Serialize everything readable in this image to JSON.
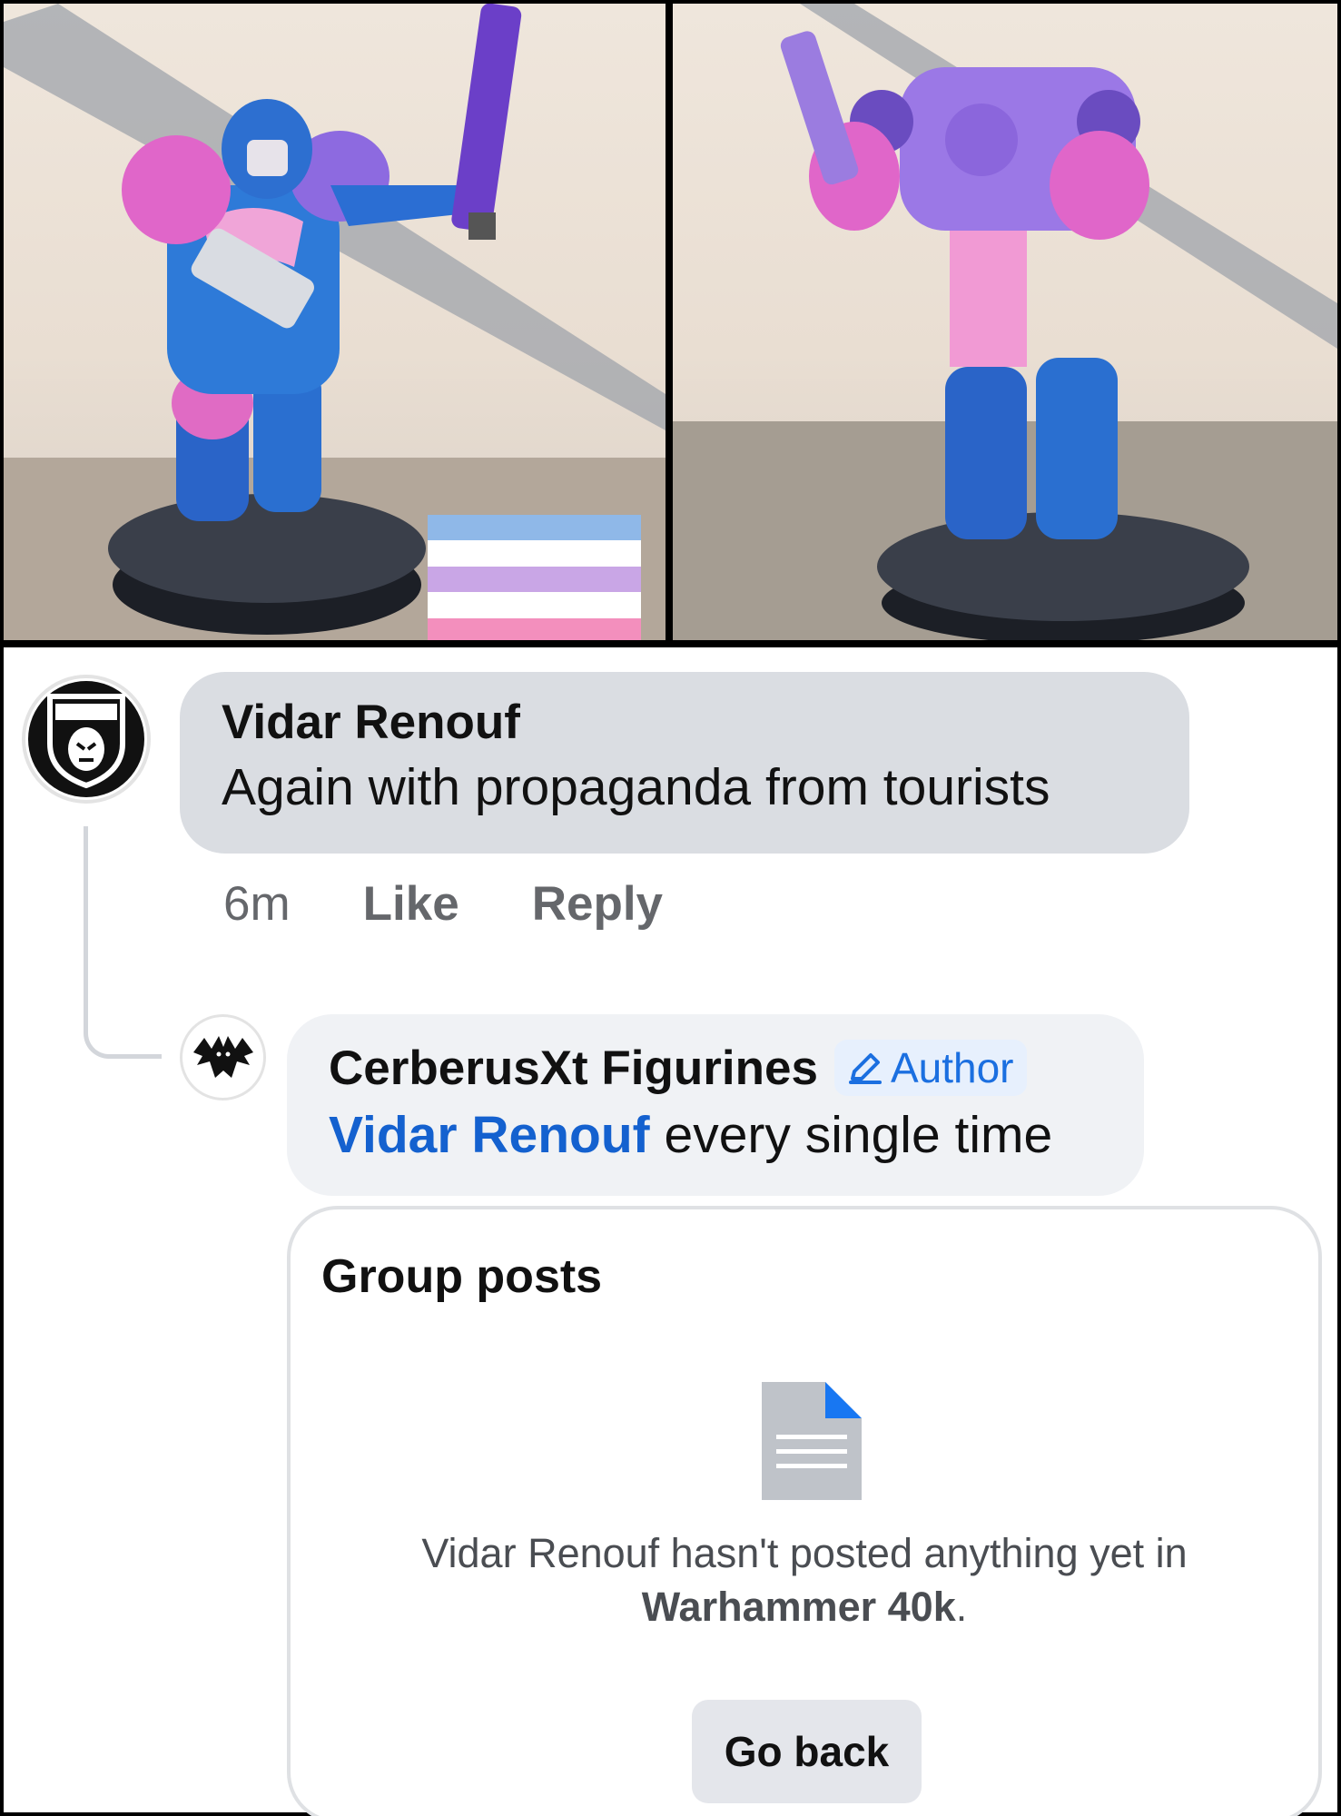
{
  "photos": {
    "left_alt": "Painted space marine miniature with chainsword, front view",
    "right_alt": "Painted space marine miniature, back view",
    "flag_colors": [
      "#8fb8e8",
      "#ffffff",
      "#c9a6e6",
      "#ffffff",
      "#f38fbd"
    ]
  },
  "comment": {
    "author": "Vidar Renouf",
    "text": "Again with propaganda from tourists",
    "time": "6m",
    "like_label": "Like",
    "reply_label": "Reply",
    "avatar_icon": "sting-shield-icon"
  },
  "reply": {
    "author": "CerberusXt Figurines",
    "badge": "Author",
    "badge_icon": "pencil-icon",
    "mention": "Vidar Renouf",
    "text": " every single time",
    "avatar_icon": "cerberus-logo-icon"
  },
  "card": {
    "title": "Group posts",
    "icon": "document-icon",
    "message_prefix": "Vidar Renouf hasn't posted anything yet in",
    "group_name": "Warhammer 40k",
    "message_suffix": ".",
    "button_label": "Go back"
  },
  "colors": {
    "mention": "#1461cf",
    "badge_text": "#1b6fe0",
    "bubble_primary": "#dadde2",
    "bubble_reply": "#f0f2f5"
  }
}
